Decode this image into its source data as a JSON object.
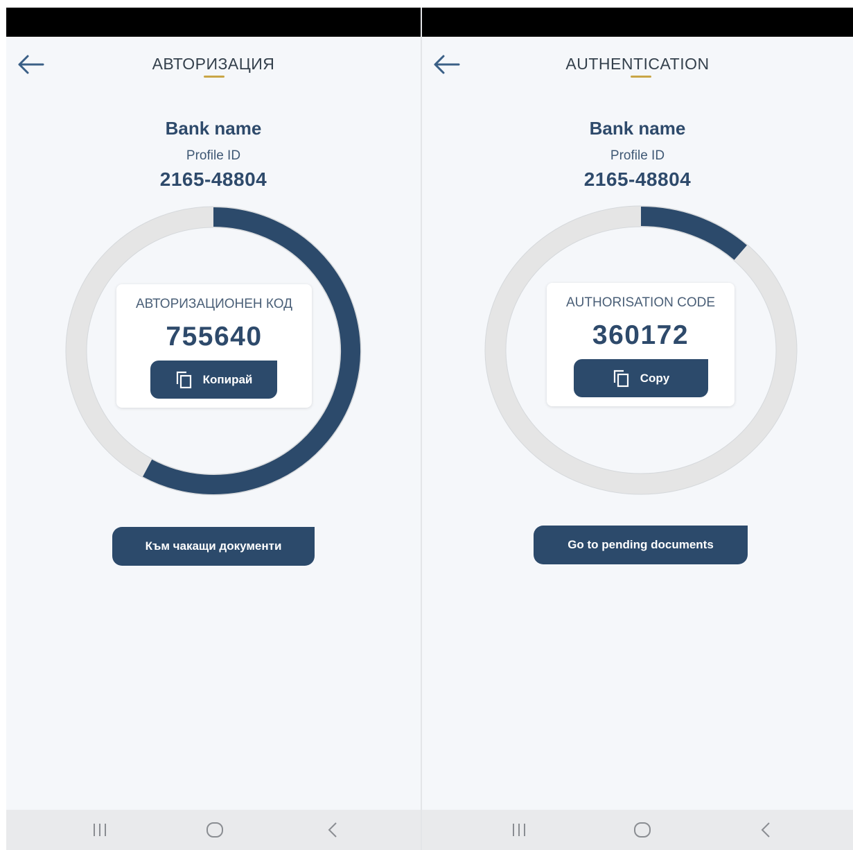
{
  "screens": [
    {
      "language": "bg",
      "header": {
        "title": "АВТОРИЗАЦИЯ",
        "back_icon": "arrow-left-icon"
      },
      "bank_name": "Bank name",
      "profile": {
        "label": "Profile ID",
        "value": "2165-48804"
      },
      "timer": {
        "remaining_fraction": 0.58
      },
      "code_card": {
        "label": "АВТОРИЗАЦИОНЕН КОД",
        "code": "755640",
        "copy_button": {
          "label": "Копирай",
          "icon": "copy-icon"
        }
      },
      "pending_button": {
        "label": "Към чакащи документи"
      }
    },
    {
      "language": "en",
      "header": {
        "title": "AUTHENTICATION",
        "back_icon": "arrow-left-icon"
      },
      "bank_name": "Bank name",
      "profile": {
        "label": "Profile ID",
        "value": "2165-48804"
      },
      "timer": {
        "remaining_fraction": 0.12
      },
      "code_card": {
        "label": "AUTHORISATION CODE",
        "code": "360172",
        "copy_button": {
          "label": "Copy",
          "icon": "copy-icon"
        }
      },
      "pending_button": {
        "label": "Go to pending documents"
      }
    }
  ],
  "system_nav": {
    "recents_icon": "recents-icon",
    "home_icon": "home-icon",
    "back_icon": "nav-back-icon"
  },
  "colors": {
    "primary": "#2c4a6b",
    "accent": "#c9a646",
    "ring_track": "#e4e4e4",
    "background": "#f5f7fa",
    "status_bar": "#000000",
    "nav_bar": "#e9eaec"
  }
}
